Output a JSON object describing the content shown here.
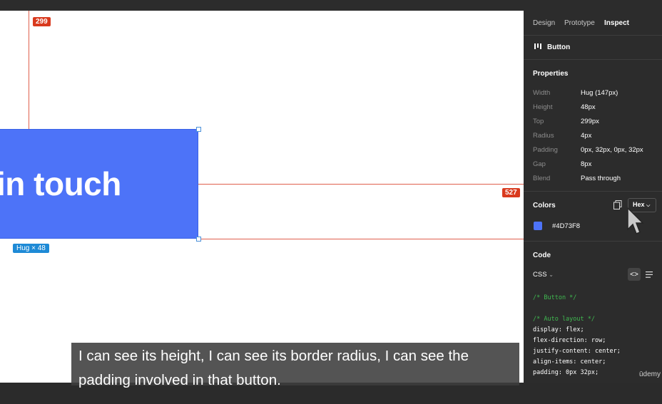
{
  "canvas": {
    "top_badge": "299",
    "right_badge": "527",
    "button_text": "in touch",
    "size_badge": "Hug × 48"
  },
  "panel": {
    "tabs": [
      "Design",
      "Prototype",
      "Inspect"
    ],
    "layer_name": "Button",
    "properties_title": "Properties",
    "properties": [
      {
        "label": "Width",
        "value": "Hug (147px)"
      },
      {
        "label": "Height",
        "value": "48px"
      },
      {
        "label": "Top",
        "value": "299px"
      },
      {
        "label": "Radius",
        "value": "4px"
      },
      {
        "label": "Padding",
        "value": "0px, 32px, 0px, 32px"
      },
      {
        "label": "Gap",
        "value": "8px"
      },
      {
        "label": "Blend",
        "value": "Pass through"
      }
    ],
    "colors_title": "Colors",
    "color_format": "Hex",
    "color_value": "#4D73F8",
    "swatch_color": "#4d73f8",
    "code_title": "Code",
    "code_language": "CSS",
    "code_lines": [
      "/* Button */",
      "/* Auto layout */",
      "display: flex;",
      "flex-direction: row;",
      "justify-content: center;",
      "align-items: center;",
      "padding: 0px 32px;"
    ]
  },
  "caption": {
    "line1": "I can see its height, I can see its border radius, I can see the",
    "line2": "padding involved in that button."
  },
  "watermark": "ūdemy"
}
